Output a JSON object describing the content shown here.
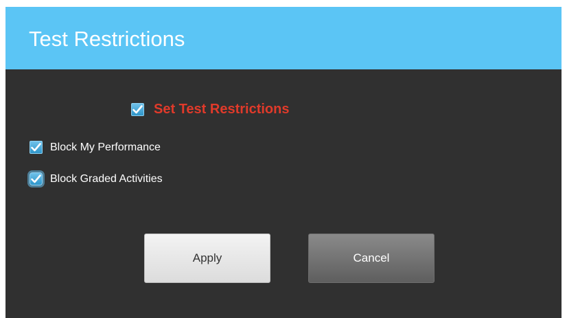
{
  "dialog": {
    "title": "Test Restrictions",
    "colors": {
      "header": "#5bc5f5",
      "body": "#303030",
      "master_label": "#e03a2a",
      "checkbox": "#3ea6dc"
    },
    "master_checkbox": {
      "label": "Set Test Restrictions",
      "checked": true,
      "icon": "checkmark-icon"
    },
    "options": [
      {
        "label": "Block My Performance",
        "checked": true,
        "icon": "checkmark-icon"
      },
      {
        "label": "Block Graded Activities",
        "checked": true,
        "focused": true,
        "icon": "checkmark-icon"
      }
    ],
    "buttons": {
      "apply_label": "Apply",
      "cancel_label": "Cancel"
    }
  }
}
